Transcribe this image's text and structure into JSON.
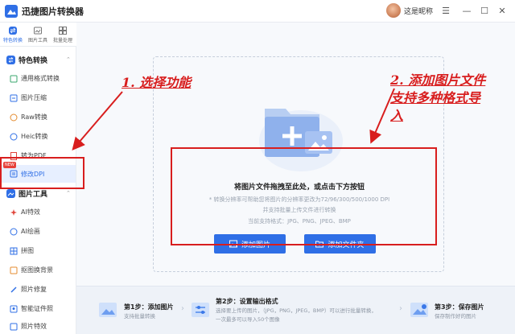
{
  "app": {
    "title": "迅捷图片转换器",
    "nickname": "这是昵称"
  },
  "window_controls": {
    "menu": "☰",
    "minimize": "—",
    "maximize": "☐",
    "close": "✕"
  },
  "topnav": [
    "特色转换",
    "图片工具",
    "批量处理"
  ],
  "sidebar": {
    "section1": "特色转换",
    "items1": [
      "通用格式转换",
      "图片压缩",
      "Raw转换",
      "Heic转换",
      "转为PDF",
      "修改DPI"
    ],
    "new_badge": "NEW",
    "section2": "图片工具",
    "items2": [
      "AI特效",
      "AI绘画",
      "拼图",
      "抠图换背景",
      "照片修复",
      "智能证件照",
      "照片特效"
    ]
  },
  "dropzone": {
    "title": "将图片文件拖拽至此处，或点击下方按钮",
    "hint1": "* 转换分辨率可帮助您将图片的分辨率更改为72/96/300/500/1000 DPI",
    "hint2": "并支持批量上传文件进行转换",
    "formats": "当前支持格式：JPG、PNG、JPEG、BMP",
    "add_image": "添加图片",
    "add_folder": "添加文件夹"
  },
  "steps": [
    {
      "title": "第1步：添加图片",
      "desc": "支持批量转换"
    },
    {
      "title": "第2步：设置输出格式",
      "desc1": "选择要上传的图片，（JPG，PNG，JPEG，BMP）可以进行批量转换，",
      "desc2": "一次最多可以导入50个图像"
    },
    {
      "title": "第3步：保存图片",
      "desc": "保存制作好的图片"
    }
  ],
  "annotations": {
    "a1": "1. 选择功能",
    "a2_line1": "2. 添加图片文件",
    "a2_line2": "支持多种格式导",
    "a2_line3": "入"
  },
  "colors": {
    "accent": "#2f6fe6",
    "annotation": "#d81e1e"
  }
}
